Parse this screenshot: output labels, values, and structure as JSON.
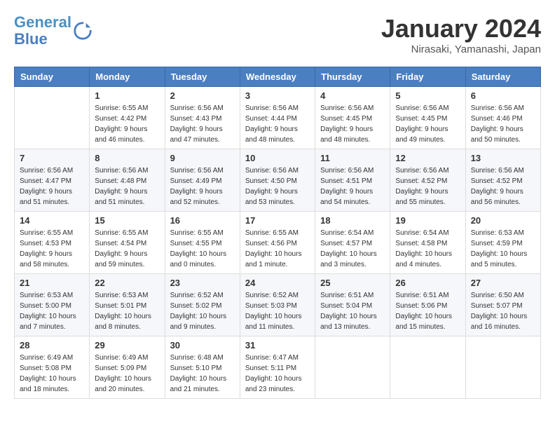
{
  "header": {
    "logo_line1": "General",
    "logo_line2": "Blue",
    "month_title": "January 2024",
    "location": "Nirasaki, Yamanashi, Japan"
  },
  "days_of_week": [
    "Sunday",
    "Monday",
    "Tuesday",
    "Wednesday",
    "Thursday",
    "Friday",
    "Saturday"
  ],
  "weeks": [
    [
      {
        "day": "",
        "info": ""
      },
      {
        "day": "1",
        "info": "Sunrise: 6:55 AM\nSunset: 4:42 PM\nDaylight: 9 hours\nand 46 minutes."
      },
      {
        "day": "2",
        "info": "Sunrise: 6:56 AM\nSunset: 4:43 PM\nDaylight: 9 hours\nand 47 minutes."
      },
      {
        "day": "3",
        "info": "Sunrise: 6:56 AM\nSunset: 4:44 PM\nDaylight: 9 hours\nand 48 minutes."
      },
      {
        "day": "4",
        "info": "Sunrise: 6:56 AM\nSunset: 4:45 PM\nDaylight: 9 hours\nand 48 minutes."
      },
      {
        "day": "5",
        "info": "Sunrise: 6:56 AM\nSunset: 4:45 PM\nDaylight: 9 hours\nand 49 minutes."
      },
      {
        "day": "6",
        "info": "Sunrise: 6:56 AM\nSunset: 4:46 PM\nDaylight: 9 hours\nand 50 minutes."
      }
    ],
    [
      {
        "day": "7",
        "info": "Sunrise: 6:56 AM\nSunset: 4:47 PM\nDaylight: 9 hours\nand 51 minutes."
      },
      {
        "day": "8",
        "info": "Sunrise: 6:56 AM\nSunset: 4:48 PM\nDaylight: 9 hours\nand 51 minutes."
      },
      {
        "day": "9",
        "info": "Sunrise: 6:56 AM\nSunset: 4:49 PM\nDaylight: 9 hours\nand 52 minutes."
      },
      {
        "day": "10",
        "info": "Sunrise: 6:56 AM\nSunset: 4:50 PM\nDaylight: 9 hours\nand 53 minutes."
      },
      {
        "day": "11",
        "info": "Sunrise: 6:56 AM\nSunset: 4:51 PM\nDaylight: 9 hours\nand 54 minutes."
      },
      {
        "day": "12",
        "info": "Sunrise: 6:56 AM\nSunset: 4:52 PM\nDaylight: 9 hours\nand 55 minutes."
      },
      {
        "day": "13",
        "info": "Sunrise: 6:56 AM\nSunset: 4:52 PM\nDaylight: 9 hours\nand 56 minutes."
      }
    ],
    [
      {
        "day": "14",
        "info": "Sunrise: 6:55 AM\nSunset: 4:53 PM\nDaylight: 9 hours\nand 58 minutes."
      },
      {
        "day": "15",
        "info": "Sunrise: 6:55 AM\nSunset: 4:54 PM\nDaylight: 9 hours\nand 59 minutes."
      },
      {
        "day": "16",
        "info": "Sunrise: 6:55 AM\nSunset: 4:55 PM\nDaylight: 10 hours\nand 0 minutes."
      },
      {
        "day": "17",
        "info": "Sunrise: 6:55 AM\nSunset: 4:56 PM\nDaylight: 10 hours\nand 1 minute."
      },
      {
        "day": "18",
        "info": "Sunrise: 6:54 AM\nSunset: 4:57 PM\nDaylight: 10 hours\nand 3 minutes."
      },
      {
        "day": "19",
        "info": "Sunrise: 6:54 AM\nSunset: 4:58 PM\nDaylight: 10 hours\nand 4 minutes."
      },
      {
        "day": "20",
        "info": "Sunrise: 6:53 AM\nSunset: 4:59 PM\nDaylight: 10 hours\nand 5 minutes."
      }
    ],
    [
      {
        "day": "21",
        "info": "Sunrise: 6:53 AM\nSunset: 5:00 PM\nDaylight: 10 hours\nand 7 minutes."
      },
      {
        "day": "22",
        "info": "Sunrise: 6:53 AM\nSunset: 5:01 PM\nDaylight: 10 hours\nand 8 minutes."
      },
      {
        "day": "23",
        "info": "Sunrise: 6:52 AM\nSunset: 5:02 PM\nDaylight: 10 hours\nand 9 minutes."
      },
      {
        "day": "24",
        "info": "Sunrise: 6:52 AM\nSunset: 5:03 PM\nDaylight: 10 hours\nand 11 minutes."
      },
      {
        "day": "25",
        "info": "Sunrise: 6:51 AM\nSunset: 5:04 PM\nDaylight: 10 hours\nand 13 minutes."
      },
      {
        "day": "26",
        "info": "Sunrise: 6:51 AM\nSunset: 5:06 PM\nDaylight: 10 hours\nand 15 minutes."
      },
      {
        "day": "27",
        "info": "Sunrise: 6:50 AM\nSunset: 5:07 PM\nDaylight: 10 hours\nand 16 minutes."
      }
    ],
    [
      {
        "day": "28",
        "info": "Sunrise: 6:49 AM\nSunset: 5:08 PM\nDaylight: 10 hours\nand 18 minutes."
      },
      {
        "day": "29",
        "info": "Sunrise: 6:49 AM\nSunset: 5:09 PM\nDaylight: 10 hours\nand 20 minutes."
      },
      {
        "day": "30",
        "info": "Sunrise: 6:48 AM\nSunset: 5:10 PM\nDaylight: 10 hours\nand 21 minutes."
      },
      {
        "day": "31",
        "info": "Sunrise: 6:47 AM\nSunset: 5:11 PM\nDaylight: 10 hours\nand 23 minutes."
      },
      {
        "day": "",
        "info": ""
      },
      {
        "day": "",
        "info": ""
      },
      {
        "day": "",
        "info": ""
      }
    ]
  ]
}
